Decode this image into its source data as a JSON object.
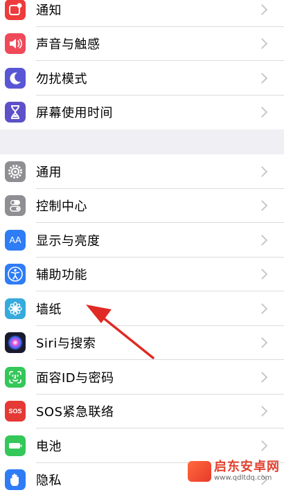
{
  "group1": [
    {
      "label": "通知",
      "icon": "notifications-icon",
      "color": "#ee3b3b"
    },
    {
      "label": "声音与触感",
      "icon": "speaker-icon",
      "color": "#ef4a5a"
    },
    {
      "label": "勿扰模式",
      "icon": "moon-icon",
      "color": "#5956d6"
    },
    {
      "label": "屏幕使用时间",
      "icon": "hourglass-icon",
      "color": "#5e50c8"
    }
  ],
  "group2": [
    {
      "label": "通用",
      "icon": "gear-icon",
      "color": "#8e8e93"
    },
    {
      "label": "控制中心",
      "icon": "toggles-icon",
      "color": "#8e8e93"
    },
    {
      "label": "显示与亮度",
      "icon": "text-size-icon",
      "color": "#2e7cf6"
    },
    {
      "label": "辅助功能",
      "icon": "accessibility-icon",
      "color": "#2e7cf6"
    },
    {
      "label": "墙纸",
      "icon": "flower-icon",
      "color": "#36aadc"
    },
    {
      "label": "Siri与搜索",
      "icon": "siri-icon",
      "color": "#1a1a2e"
    },
    {
      "label": "面容ID与密码",
      "icon": "face-id-icon",
      "color": "#34c759"
    },
    {
      "label": "SOS紧急联络",
      "icon": "sos-icon",
      "color": "#e53935"
    },
    {
      "label": "电池",
      "icon": "battery-icon",
      "color": "#34c759"
    },
    {
      "label": "隐私",
      "icon": "hand-icon",
      "color": "#2e7cf6"
    }
  ],
  "icon_text": {
    "text_size": "AA",
    "sos": "SOS"
  },
  "watermark": {
    "title": "启东安卓网",
    "url": "www.qdltdq.com"
  }
}
